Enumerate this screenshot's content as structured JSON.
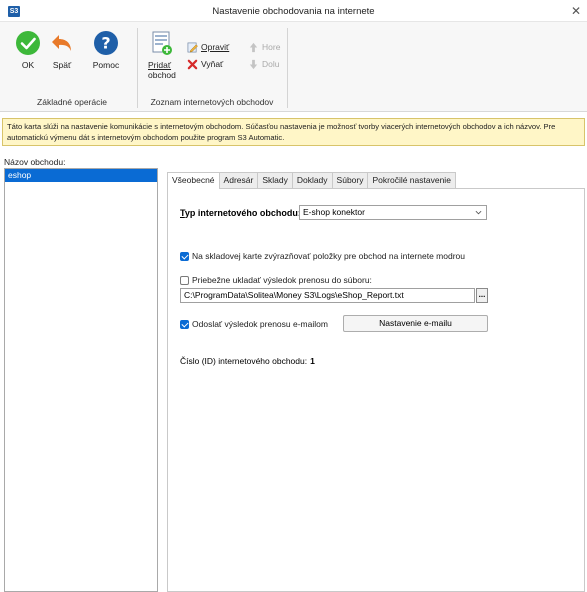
{
  "window": {
    "app_badge": "S3",
    "title": "Nastavenie obchodovania na internete",
    "close_glyph": "✕"
  },
  "ribbon": {
    "groups": [
      {
        "label": "Základné operácie"
      },
      {
        "label": "Zoznam internetových obchodov"
      }
    ],
    "ok_label": "OK",
    "back_label": "Späť",
    "help_label": "Pomoc",
    "add_label_line1": "Pridať",
    "add_label_line2": "obchod",
    "edit_label": "Opraviť",
    "remove_label": "Vyňať",
    "up_label": "Hore",
    "down_label": "Dolu"
  },
  "info": {
    "text": "Táto karta slúži na nastavenie komunikácie s internetovým obchodom. Súčasťou nastavenia je možnosť tvorby viacerých internetových obchodov a ich názvov. Pre automatickú výmenu dát s internetovým obchodom použite program S3 Automatic."
  },
  "shop_list": {
    "label": "Názov obchodu:",
    "items": [
      {
        "name": "eshop",
        "selected": true
      }
    ]
  },
  "tabs": [
    {
      "label": "Všeobecné",
      "active": true
    },
    {
      "label": "Adresár",
      "active": false
    },
    {
      "label": "Sklady",
      "active": false
    },
    {
      "label": "Doklady",
      "active": false
    },
    {
      "label": "Súbory",
      "active": false
    },
    {
      "label": "Pokročilé nastavenie",
      "active": false
    }
  ],
  "general": {
    "type_label": "Typ internetového obchodu:",
    "type_value": "E-shop konektor",
    "highlight_checkbox": {
      "label": "Na skladovej karte zvýrazňovať položky pre obchod na internete modrou",
      "checked": true
    },
    "save_log_checkbox": {
      "label": "Priebežne ukladať výsledok prenosu do súboru:",
      "checked": false
    },
    "log_path": "C:\\ProgramData\\Solitea\\Money S3\\Logs\\eShop_Report.txt",
    "browse_label": "...",
    "email_checkbox": {
      "label": "Odoslať výsledok prenosu e-mailom",
      "checked": true
    },
    "email_settings_button": "Nastavenie e-mailu",
    "id_label": "Číslo (ID) internetového obchodu:",
    "id_value": "1"
  },
  "colors": {
    "accent": "#0a6bd4",
    "info_background": "#fff6c7",
    "ok_green": "#3db83a",
    "back_orange": "#e87a2a",
    "help_blue": "#1f5fa8",
    "remove_red": "#d62a2a"
  },
  "icons": {
    "ok": "ok-check-icon",
    "back": "back-arrow-icon",
    "help": "help-question-icon",
    "add": "add-shop-icon",
    "edit": "edit-pencil-icon",
    "remove": "remove-x-icon",
    "up": "arrow-up-icon",
    "down": "arrow-down-icon"
  }
}
